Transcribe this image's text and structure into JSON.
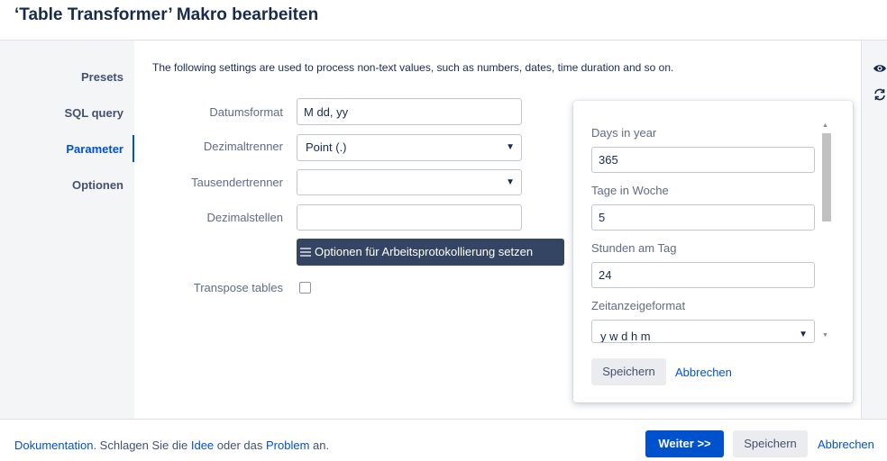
{
  "title": "‘Table Transformer’ Makro bearbeiten",
  "sidebar": {
    "items": [
      {
        "label": "Presets"
      },
      {
        "label": "SQL query"
      },
      {
        "label": "Parameter"
      },
      {
        "label": "Optionen"
      }
    ],
    "active": "Parameter"
  },
  "intro": "The following settings are used to process non-text values, such as numbers, dates, time duration and so on.",
  "form": {
    "date_format_label": "Datumsformat",
    "date_format_value": "M dd, yy",
    "decimal_sep_label": "Dezimaltrenner",
    "decimal_sep_value": "Point (.)",
    "thousands_sep_label": "Tausendertrenner",
    "thousands_sep_value": "",
    "decimal_places_label": "Dezimalstellen",
    "decimal_places_value": "",
    "worklog_button": "Optionen für Arbeitsprotokollierung setzen",
    "transpose_label": "Transpose tables",
    "transpose_checked": false
  },
  "popup": {
    "days_label": "Days in year",
    "days_value": "365",
    "week_label": "Tage in Woche",
    "week_value": "5",
    "hours_label": "Stunden am Tag",
    "hours_value": "24",
    "timefmt_label": "Zeitanzeigeformat",
    "timefmt_value": "y w d h m",
    "save": "Speichern",
    "cancel": "Abbrechen"
  },
  "rightrail": {
    "icons": [
      "eye-icon",
      "refresh-icon"
    ]
  },
  "footer": {
    "link_doc": "Dokumentation",
    "text1": ". Schlagen Sie die ",
    "link_idea": "Idee",
    "text2": " oder das ",
    "link_problem": "Problem",
    "text3": " an.",
    "next": "Weiter >>",
    "save": "Speichern",
    "cancel": "Abbrechen"
  },
  "colors": {
    "accent": "#0052cc",
    "dark_button": "#344563",
    "sidebar_bg": "#f4f5f7"
  }
}
